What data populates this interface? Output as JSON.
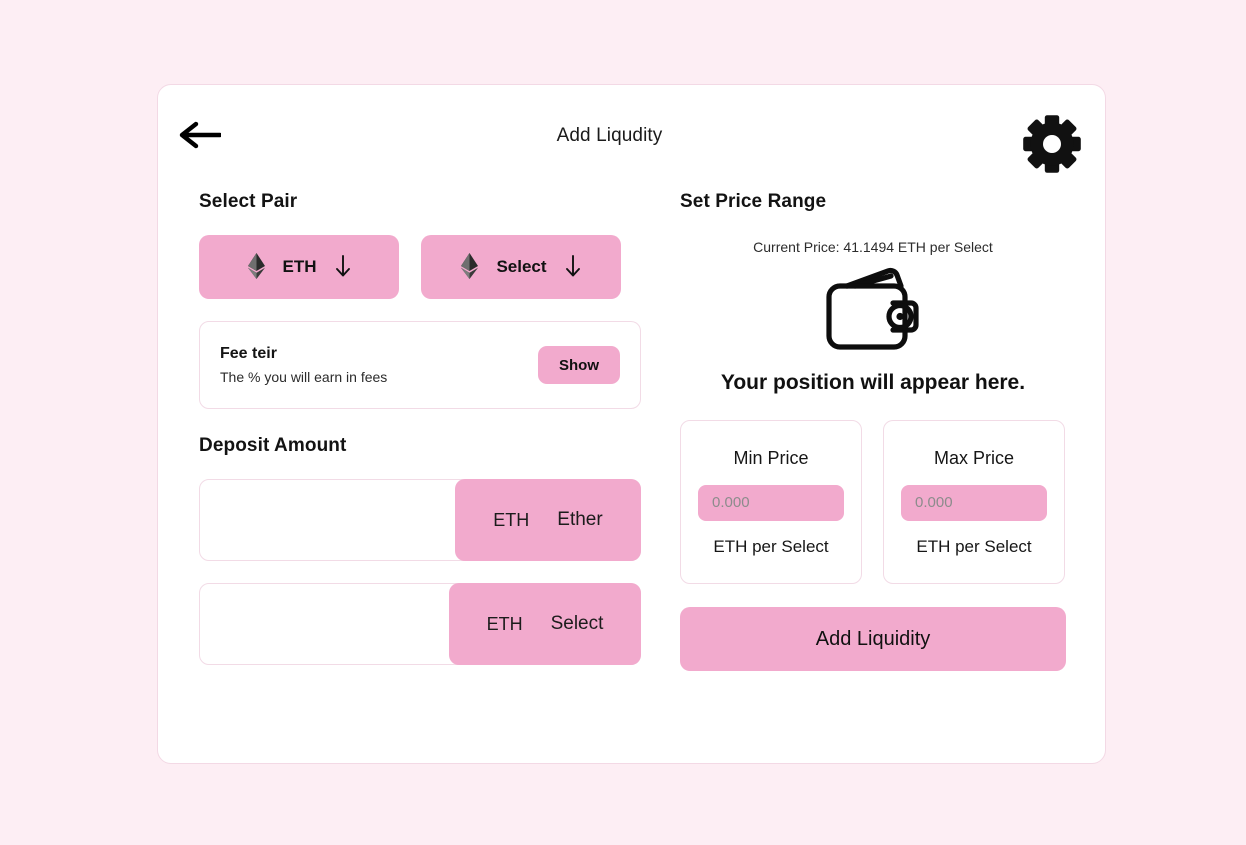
{
  "app": {
    "title": "Add Liqudity",
    "background_color": "#fdeef4",
    "card_color": "#ffffff",
    "accent_color": "#f2aacd",
    "border_color": "#f2dbe6"
  },
  "header": {
    "back_icon": "arrow-left-icon",
    "title": "Add Liqudity",
    "settings_icon": "gear-icon"
  },
  "select_pair": {
    "heading": "Select Pair",
    "tokens": [
      {
        "icon": "ethereum-icon",
        "label": "ETH",
        "chevron": "arrow-down-icon"
      },
      {
        "icon": "ethereum-icon",
        "label": "Select",
        "chevron": "arrow-down-icon"
      }
    ]
  },
  "fee_tier": {
    "title": "Fee teir",
    "subtitle": "The % you will earn in fees",
    "button_label": "Show"
  },
  "deposit": {
    "heading": "Deposit Amount",
    "rows": [
      {
        "value": "",
        "placeholder": "",
        "symbol": "ETH",
        "name": "Ether"
      },
      {
        "value": "",
        "placeholder": "",
        "symbol": "ETH",
        "name": "Select"
      }
    ]
  },
  "price_range": {
    "heading": "Set Price Range",
    "current_price": "Current Price: 41.1494 ETH per Select",
    "illustration_icon": "wallet-icon",
    "position_message": "Your position will appear here.",
    "min": {
      "label": "Min Price",
      "value": "",
      "placeholder": "0.000",
      "unit": "ETH per Select"
    },
    "max": {
      "label": "Max Price",
      "value": "",
      "placeholder": "0.000",
      "unit": "ETH per Select"
    },
    "submit_label": "Add Liquidity"
  }
}
